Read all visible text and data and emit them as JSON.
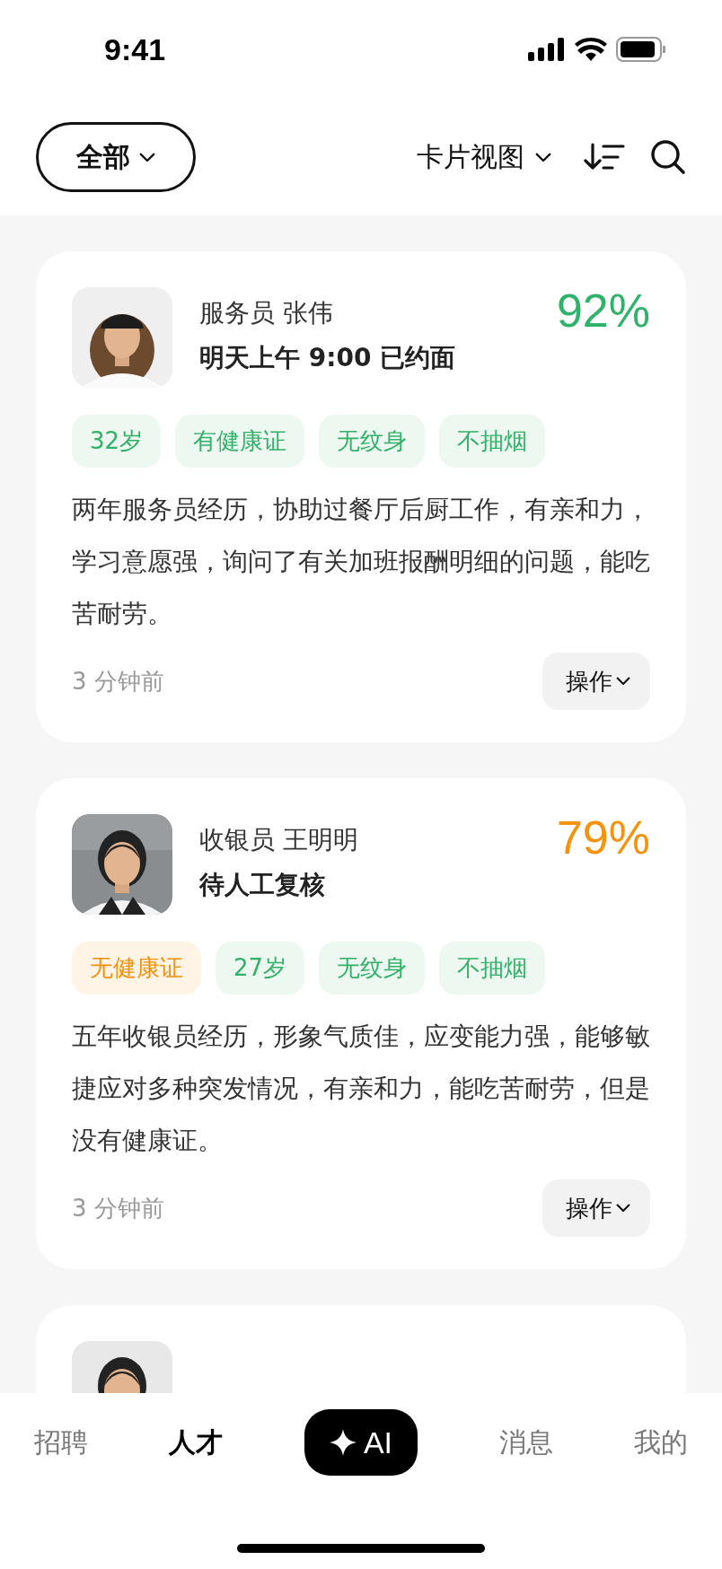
{
  "status_bar": {
    "time": "9:41"
  },
  "top_bar": {
    "filter": "全部",
    "view": "卡片视图"
  },
  "cards": [
    {
      "title": "服务员 张伟",
      "status": "明天上午 9:00 已约面",
      "score": "92%",
      "color": "#2fb36a",
      "tags": [
        {
          "label": "32岁",
          "kind": "positive"
        },
        {
          "label": "有健康证",
          "kind": "positive"
        },
        {
          "label": "无纹身",
          "kind": "positive"
        },
        {
          "label": "不抽烟",
          "kind": "positive"
        }
      ],
      "summary": "两年服务员经历，协助过餐厅后厨工作，有亲和力，学习意愿强，询问了有关加班报酬明细的问题，能吃苦耐劳。",
      "time": "3 分钟前",
      "action": "操作"
    },
    {
      "title": "收银员 王明明",
      "status": "待人工复核",
      "score": "79%",
      "color": "#f5930c",
      "tags": [
        {
          "label": "无健康证",
          "kind": "warning"
        },
        {
          "label": "27岁",
          "kind": "positive"
        },
        {
          "label": "无纹身",
          "kind": "positive"
        },
        {
          "label": "不抽烟",
          "kind": "positive"
        }
      ],
      "summary": "五年收银员经历，形象气质佳，应变能力强，能够敏捷应对多种突发情况，有亲和力，能吃苦耐劳，但是没有健康证。",
      "time": "3 分钟前",
      "action": "操作"
    }
  ],
  "tab_bar": [
    {
      "label": "招聘",
      "kind": "text",
      "selected": false
    },
    {
      "label": "人才",
      "kind": "text",
      "selected": true
    },
    {
      "label": "AI",
      "kind": "ai",
      "selected": false
    },
    {
      "label": "消息",
      "kind": "text",
      "selected": false
    },
    {
      "label": "我的",
      "kind": "text",
      "selected": false
    }
  ]
}
